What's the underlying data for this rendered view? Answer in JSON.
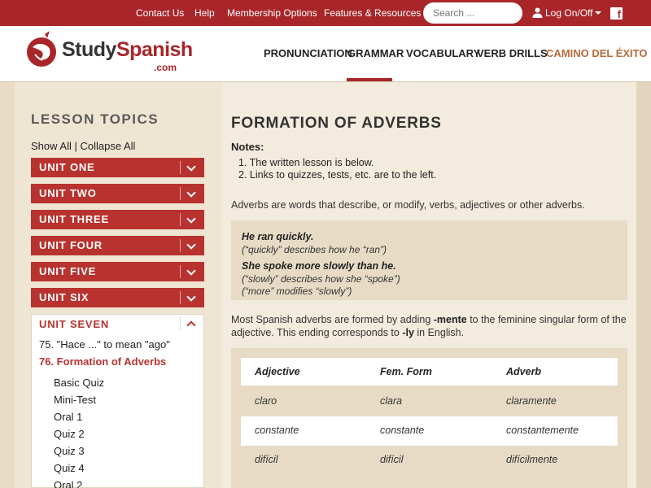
{
  "topbar": {
    "links": [
      "Contact Us",
      "Help",
      "Membership Options",
      "Features & Resources"
    ],
    "search_placeholder": "Search ...",
    "login_label": "Log On/Off",
    "facebook_glyph": "f"
  },
  "header": {
    "logo_study": "Study",
    "logo_spanish": "Spanish",
    "logo_com": ".com",
    "nav": [
      "PRONUNCIATION",
      "GRAMMAR",
      "VOCABULARY",
      "VERB DRILLS",
      "CAMINO DEL ÉXITO"
    ],
    "active_nav": "GRAMMAR"
  },
  "sidebar": {
    "title": "LESSON TOPICS",
    "show_collapse": "Show All | Collapse All",
    "units": [
      "UNIT ONE",
      "UNIT TWO",
      "UNIT THREE",
      "UNIT FOUR",
      "UNIT FIVE",
      "UNIT SIX"
    ],
    "open_unit": {
      "label": "UNIT SEVEN",
      "lessons": [
        "75. \"Hace ...\" to mean \"ago\"",
        "76. Formation of Adverbs"
      ],
      "active_lesson": "76. Formation of Adverbs",
      "subitems": [
        "Basic Quiz",
        "Mini-Test",
        "Oral 1",
        "Quiz 2",
        "Quiz 3",
        "Quiz 4",
        "Oral 2"
      ]
    }
  },
  "main": {
    "title": "FORMATION OF ADVERBS",
    "notes_heading": "Notes:",
    "notes": [
      "1. The written lesson is below.",
      "2. Links to quizzes, tests, etc. are to the left."
    ],
    "intro": "Adverbs are words that describe, or modify, verbs, adjectives or other adverbs.",
    "examples": [
      {
        "sentence": "He ran quickly.",
        "notes": [
          "(“quickly” describes how he “ran”)"
        ]
      },
      {
        "sentence": "She spoke more slowly than he.",
        "notes": [
          "(“slowly” describes how she “spoke”)",
          "(“more” modifies “slowly”)"
        ]
      }
    ],
    "formation": {
      "p1": "Most Spanish adverbs are formed by adding ",
      "b1": "-mente",
      "p2": " to the feminine singular form of the adjective. This ending corresponds to ",
      "b2": "-ly",
      "p3": " in English."
    },
    "table": {
      "headers": [
        "Adjective",
        "Fem. Form",
        "Adverb"
      ],
      "rows": [
        [
          "claro",
          "clara",
          "claramente"
        ],
        [
          "constante",
          "constante",
          "constantemente"
        ],
        [
          "difícil",
          "difícil",
          "difícilmente"
        ]
      ]
    }
  },
  "colors": {
    "brand_red": "#a8262a",
    "unit_red": "#b8332f",
    "camino": "#b56a3a",
    "page_bg": "#e9dcc6"
  }
}
